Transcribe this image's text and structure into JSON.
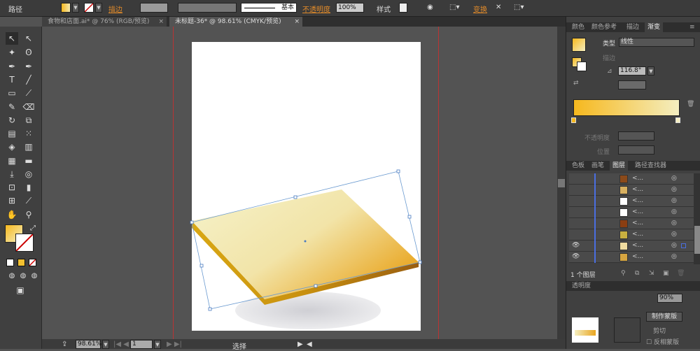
{
  "control_bar": {
    "object_type": "路径",
    "stroke_label": "描边",
    "stroke_style": "基本",
    "opacity_label": "不透明度",
    "opacity_value": "100%",
    "style_label": "样式",
    "transform_label": "变换"
  },
  "doc_tabs": [
    {
      "label": "食物和店面.ai* @ 76% (RGB/预览)",
      "active": false
    },
    {
      "label": "未标题-36* @ 98.61% (CMYK/预览)",
      "active": true
    }
  ],
  "colors": {
    "gradient_start": "#f6b81e",
    "gradient_end": "#f4eec0",
    "guide": "#c0392b",
    "workspace": "#535353"
  },
  "gradient_panel": {
    "tabs": [
      "颜色",
      "颜色参考",
      "描边",
      "渐变"
    ],
    "active_tab": "渐变",
    "type_label": "类型",
    "type_value": "线性",
    "stroke_label": "描边",
    "angle_value": "116.8°",
    "opacity_label": "不透明度",
    "position_label": "位置"
  },
  "layers_panel": {
    "tabs": [
      "色板",
      "画笔",
      "图层",
      "路径查找器"
    ],
    "active_tab": "图层",
    "rows": [
      {
        "name": "<...",
        "visible": false
      },
      {
        "name": "<...",
        "visible": false
      },
      {
        "name": "<...",
        "visible": false
      },
      {
        "name": "<...",
        "visible": false
      },
      {
        "name": "<...",
        "visible": false
      },
      {
        "name": "<...",
        "visible": false
      },
      {
        "name": "<...",
        "visible": true,
        "selected": true
      },
      {
        "name": "<...",
        "visible": true
      }
    ],
    "footer": "1 个图层"
  },
  "transparency_panel": {
    "title": "透明度",
    "opacity_value": "90%",
    "make_mask": "制作蒙版",
    "clip_label": "剪切",
    "invert_label": "反相蒙版"
  },
  "status_bar": {
    "zoom": "98.61%",
    "page": "1",
    "tool": "选择"
  }
}
